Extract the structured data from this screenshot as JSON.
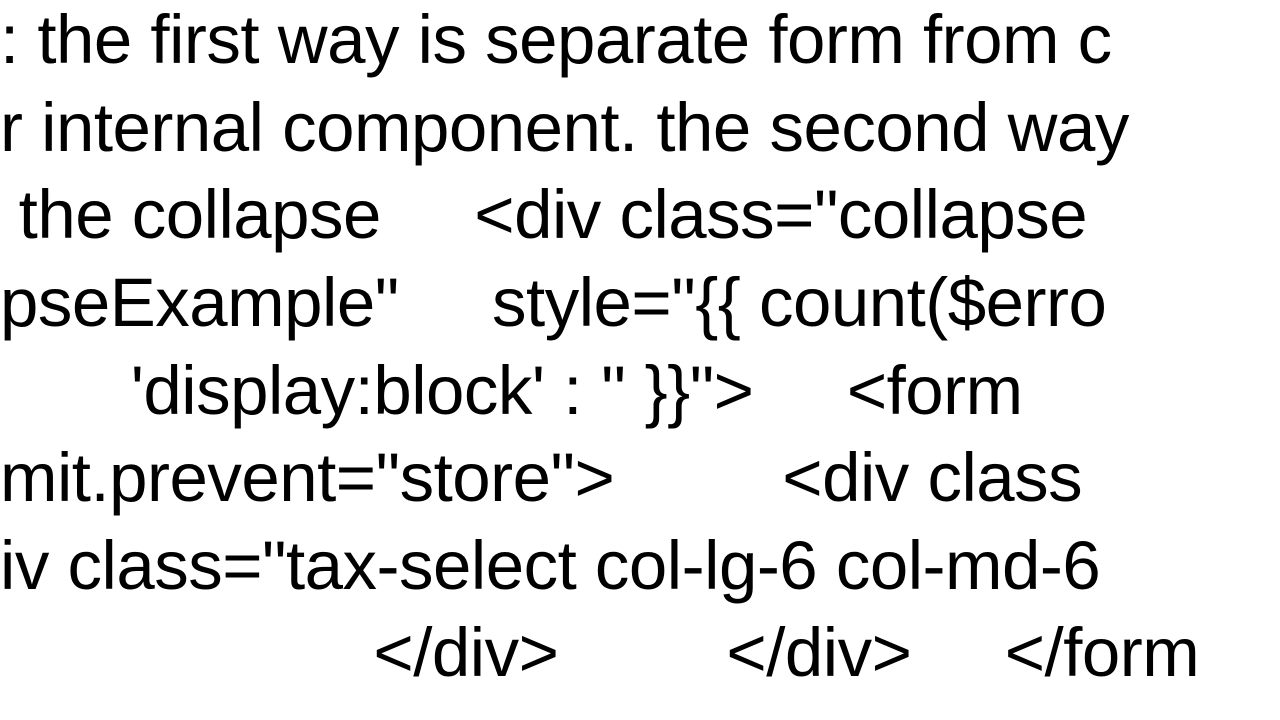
{
  "lines": {
    "l1": ": the first way is separate form from c",
    "l2": "r internal component. the second way",
    "l3": " the collapse     <div class=\"collapse",
    "l4": "pseExample\"     style=\"{{ count($erro",
    "l5": "       'display:block' : '' }}\">     <form",
    "l6": "mit.prevent=\"store\">         <div class",
    "l7": "iv class=\"tax-select col-lg-6 col-md-6",
    "l8": "                    </div>         </div>     </form"
  }
}
